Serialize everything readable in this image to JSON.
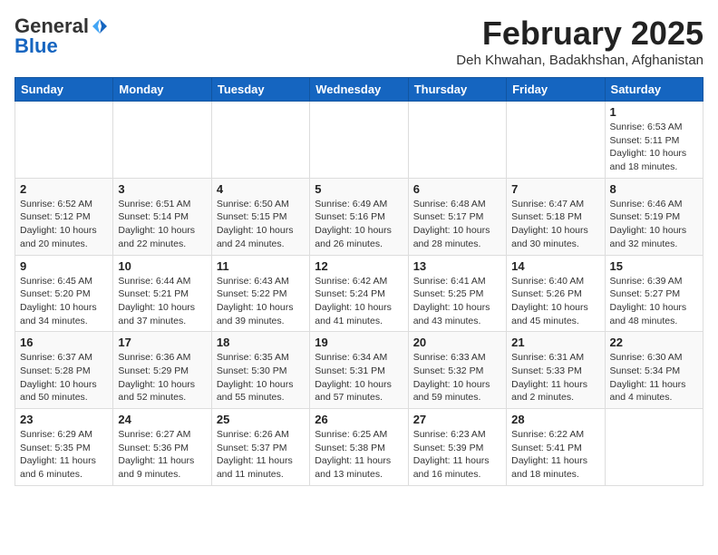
{
  "header": {
    "logo_general": "General",
    "logo_blue": "Blue",
    "month": "February 2025",
    "location": "Deh Khwahan, Badakhshan, Afghanistan"
  },
  "weekdays": [
    "Sunday",
    "Monday",
    "Tuesday",
    "Wednesday",
    "Thursday",
    "Friday",
    "Saturday"
  ],
  "weeks": [
    [
      {
        "day": "",
        "info": ""
      },
      {
        "day": "",
        "info": ""
      },
      {
        "day": "",
        "info": ""
      },
      {
        "day": "",
        "info": ""
      },
      {
        "day": "",
        "info": ""
      },
      {
        "day": "",
        "info": ""
      },
      {
        "day": "1",
        "info": "Sunrise: 6:53 AM\nSunset: 5:11 PM\nDaylight: 10 hours and 18 minutes."
      }
    ],
    [
      {
        "day": "2",
        "info": "Sunrise: 6:52 AM\nSunset: 5:12 PM\nDaylight: 10 hours and 20 minutes."
      },
      {
        "day": "3",
        "info": "Sunrise: 6:51 AM\nSunset: 5:14 PM\nDaylight: 10 hours and 22 minutes."
      },
      {
        "day": "4",
        "info": "Sunrise: 6:50 AM\nSunset: 5:15 PM\nDaylight: 10 hours and 24 minutes."
      },
      {
        "day": "5",
        "info": "Sunrise: 6:49 AM\nSunset: 5:16 PM\nDaylight: 10 hours and 26 minutes."
      },
      {
        "day": "6",
        "info": "Sunrise: 6:48 AM\nSunset: 5:17 PM\nDaylight: 10 hours and 28 minutes."
      },
      {
        "day": "7",
        "info": "Sunrise: 6:47 AM\nSunset: 5:18 PM\nDaylight: 10 hours and 30 minutes."
      },
      {
        "day": "8",
        "info": "Sunrise: 6:46 AM\nSunset: 5:19 PM\nDaylight: 10 hours and 32 minutes."
      }
    ],
    [
      {
        "day": "9",
        "info": "Sunrise: 6:45 AM\nSunset: 5:20 PM\nDaylight: 10 hours and 34 minutes."
      },
      {
        "day": "10",
        "info": "Sunrise: 6:44 AM\nSunset: 5:21 PM\nDaylight: 10 hours and 37 minutes."
      },
      {
        "day": "11",
        "info": "Sunrise: 6:43 AM\nSunset: 5:22 PM\nDaylight: 10 hours and 39 minutes."
      },
      {
        "day": "12",
        "info": "Sunrise: 6:42 AM\nSunset: 5:24 PM\nDaylight: 10 hours and 41 minutes."
      },
      {
        "day": "13",
        "info": "Sunrise: 6:41 AM\nSunset: 5:25 PM\nDaylight: 10 hours and 43 minutes."
      },
      {
        "day": "14",
        "info": "Sunrise: 6:40 AM\nSunset: 5:26 PM\nDaylight: 10 hours and 45 minutes."
      },
      {
        "day": "15",
        "info": "Sunrise: 6:39 AM\nSunset: 5:27 PM\nDaylight: 10 hours and 48 minutes."
      }
    ],
    [
      {
        "day": "16",
        "info": "Sunrise: 6:37 AM\nSunset: 5:28 PM\nDaylight: 10 hours and 50 minutes."
      },
      {
        "day": "17",
        "info": "Sunrise: 6:36 AM\nSunset: 5:29 PM\nDaylight: 10 hours and 52 minutes."
      },
      {
        "day": "18",
        "info": "Sunrise: 6:35 AM\nSunset: 5:30 PM\nDaylight: 10 hours and 55 minutes."
      },
      {
        "day": "19",
        "info": "Sunrise: 6:34 AM\nSunset: 5:31 PM\nDaylight: 10 hours and 57 minutes."
      },
      {
        "day": "20",
        "info": "Sunrise: 6:33 AM\nSunset: 5:32 PM\nDaylight: 10 hours and 59 minutes."
      },
      {
        "day": "21",
        "info": "Sunrise: 6:31 AM\nSunset: 5:33 PM\nDaylight: 11 hours and 2 minutes."
      },
      {
        "day": "22",
        "info": "Sunrise: 6:30 AM\nSunset: 5:34 PM\nDaylight: 11 hours and 4 minutes."
      }
    ],
    [
      {
        "day": "23",
        "info": "Sunrise: 6:29 AM\nSunset: 5:35 PM\nDaylight: 11 hours and 6 minutes."
      },
      {
        "day": "24",
        "info": "Sunrise: 6:27 AM\nSunset: 5:36 PM\nDaylight: 11 hours and 9 minutes."
      },
      {
        "day": "25",
        "info": "Sunrise: 6:26 AM\nSunset: 5:37 PM\nDaylight: 11 hours and 11 minutes."
      },
      {
        "day": "26",
        "info": "Sunrise: 6:25 AM\nSunset: 5:38 PM\nDaylight: 11 hours and 13 minutes."
      },
      {
        "day": "27",
        "info": "Sunrise: 6:23 AM\nSunset: 5:39 PM\nDaylight: 11 hours and 16 minutes."
      },
      {
        "day": "28",
        "info": "Sunrise: 6:22 AM\nSunset: 5:41 PM\nDaylight: 11 hours and 18 minutes."
      },
      {
        "day": "",
        "info": ""
      }
    ]
  ]
}
